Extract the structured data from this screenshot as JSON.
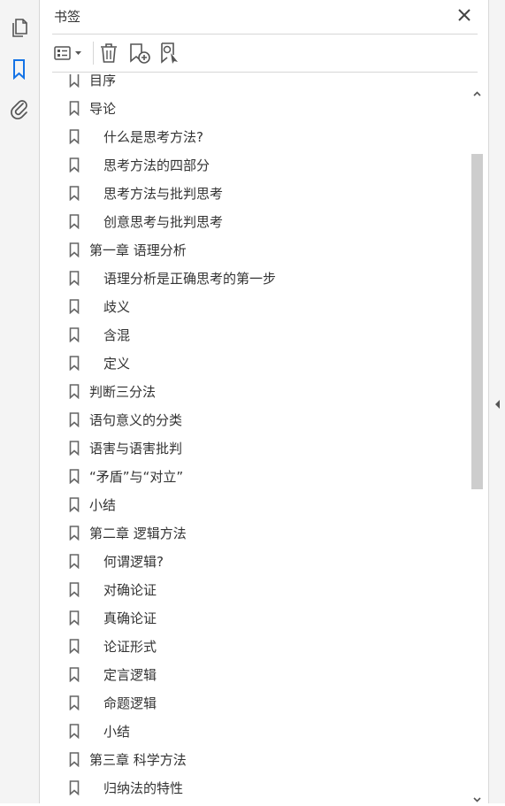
{
  "panel": {
    "title": "书签"
  },
  "toolbar": {
    "options_icon": "list-options-icon",
    "delete_icon": "trash-icon",
    "new_bookmark_icon": "bookmark-add-icon",
    "find_bookmark_icon": "bookmark-search-icon"
  },
  "left_rail": {
    "items": [
      "pages-icon",
      "bookmarks-icon",
      "attachments-icon"
    ],
    "active": "bookmarks-icon",
    "active_color": "#1473e6"
  },
  "bookmarks": [
    {
      "label": "目序",
      "level": 0
    },
    {
      "label": "导论",
      "level": 0
    },
    {
      "label": "什么是思考方法?",
      "level": 1
    },
    {
      "label": "思考方法的四部分",
      "level": 1
    },
    {
      "label": "思考方法与批判思考",
      "level": 1
    },
    {
      "label": "创意思考与批判思考",
      "level": 1
    },
    {
      "label": "第一章  语理分析",
      "level": 0
    },
    {
      "label": "语理分析是正确思考的第一步",
      "level": 1
    },
    {
      "label": "歧义",
      "level": 1
    },
    {
      "label": "含混",
      "level": 1
    },
    {
      "label": "定义",
      "level": 1
    },
    {
      "label": "判断三分法",
      "level": 0
    },
    {
      "label": "语句意义的分类",
      "level": 0
    },
    {
      "label": "语害与语害批判",
      "level": 0
    },
    {
      "label": "“矛盾”与“对立”",
      "level": 0
    },
    {
      "label": "小结",
      "level": 0
    },
    {
      "label": "第二章  逻辑方法",
      "level": 0
    },
    {
      "label": "何谓逻辑?",
      "level": 1
    },
    {
      "label": "对确论证",
      "level": 1
    },
    {
      "label": "真确论证",
      "level": 1
    },
    {
      "label": "论证形式",
      "level": 1
    },
    {
      "label": "定言逻辑",
      "level": 1
    },
    {
      "label": "命题逻辑",
      "level": 1
    },
    {
      "label": "小结",
      "level": 1
    },
    {
      "label": "第三章  科学方法",
      "level": 0
    },
    {
      "label": "归纳法的特性",
      "level": 1
    }
  ]
}
